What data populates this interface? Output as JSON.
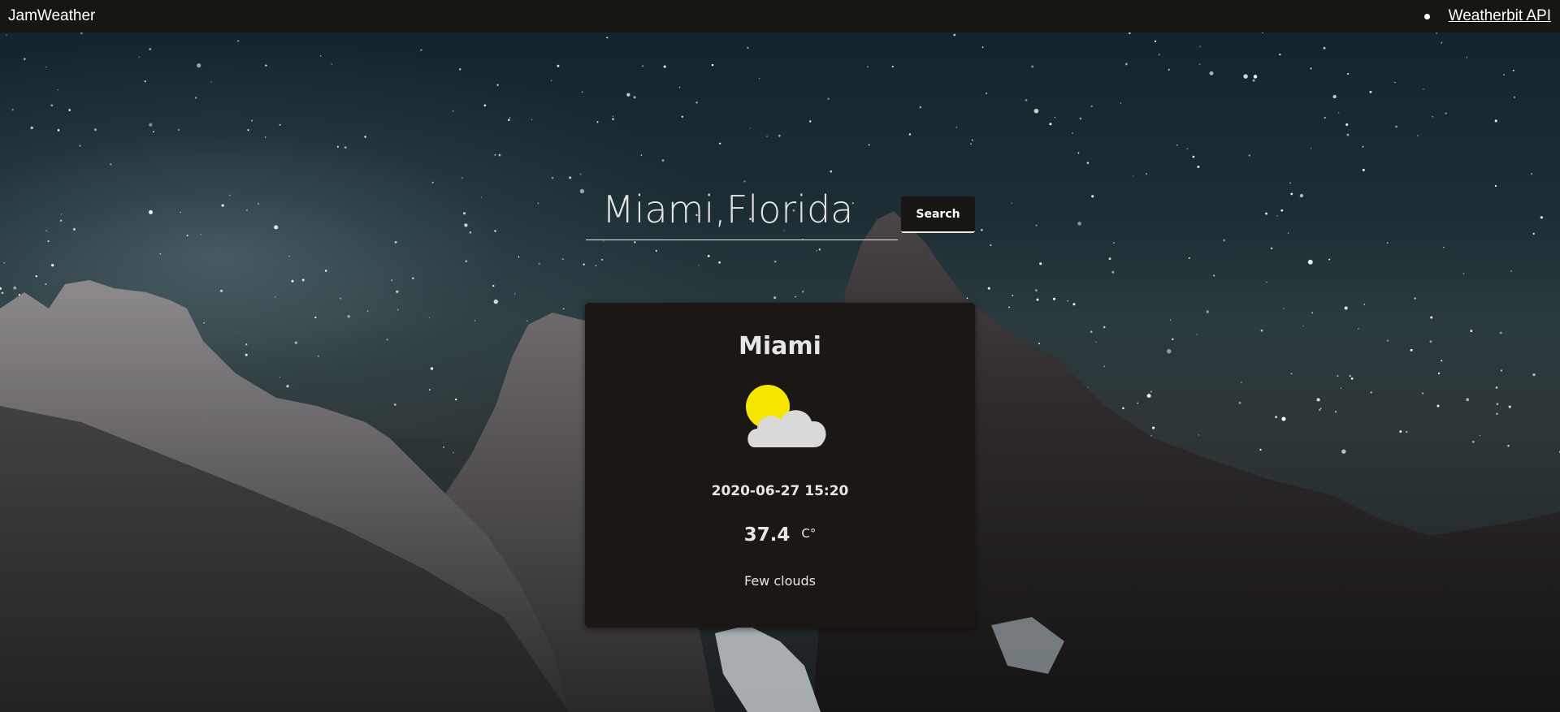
{
  "navbar": {
    "brand": "JamWeather",
    "links": [
      {
        "label": "Weatherbit API"
      }
    ]
  },
  "search": {
    "value": "Miami,Florida",
    "button_label": "Search"
  },
  "weather": {
    "city": "Miami",
    "icon": "sun-behind-cloud-icon",
    "datetime": "2020-06-27 15:20",
    "temperature": "37.4",
    "unit": "C°",
    "description": "Few clouds"
  },
  "colors": {
    "navbar_bg": "#181613",
    "card_bg": "#1a1715",
    "sun": "#f5e600",
    "cloud": "#d9d9d9"
  }
}
